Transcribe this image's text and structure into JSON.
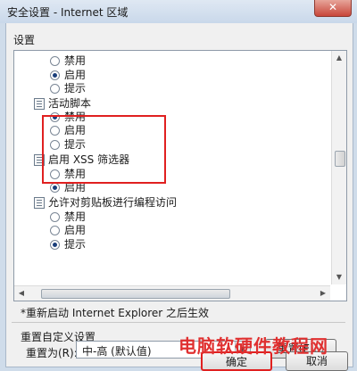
{
  "window": {
    "title": "安全设置 - Internet 区域",
    "close_glyph": "✕"
  },
  "settings_label": "设置",
  "list": {
    "rows": [
      {
        "type": "radio",
        "label": "禁用",
        "selected": false
      },
      {
        "type": "radio",
        "label": "启用",
        "selected": true
      },
      {
        "type": "radio",
        "label": "提示",
        "selected": false
      },
      {
        "type": "header",
        "label": "活动脚本"
      },
      {
        "type": "radio",
        "label": "禁用",
        "selected": true
      },
      {
        "type": "radio",
        "label": "启用",
        "selected": false
      },
      {
        "type": "radio",
        "label": "提示",
        "selected": false
      },
      {
        "type": "header",
        "label": "启用 XSS 筛选器"
      },
      {
        "type": "radio",
        "label": "禁用",
        "selected": false
      },
      {
        "type": "radio",
        "label": "启用",
        "selected": true
      },
      {
        "type": "header",
        "label": "允许对剪贴板进行编程访问"
      },
      {
        "type": "radio",
        "label": "禁用",
        "selected": false
      },
      {
        "type": "radio",
        "label": "启用",
        "selected": false
      },
      {
        "type": "radio",
        "label": "提示",
        "selected": true
      }
    ]
  },
  "note": "*重新启动 Internet Explorer 之后生效",
  "reset": {
    "caption": "重置自定义设置",
    "label": "重置为(R):",
    "value": "中-高 (默认值)",
    "button": "重置(E)..."
  },
  "buttons": {
    "ok": "确定",
    "cancel": "取消"
  },
  "watermark": "电脑软硬件教程网",
  "colors": {
    "highlight_box": "#e02020",
    "watermark": "#e03030"
  }
}
